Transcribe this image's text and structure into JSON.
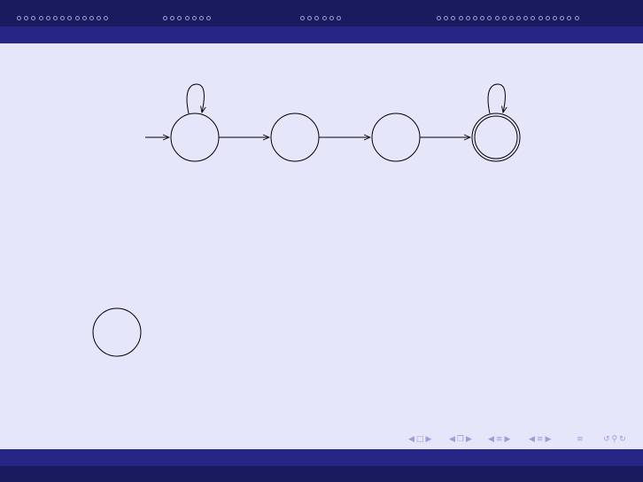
{
  "header": {
    "sections": [
      {
        "id": "s1",
        "dots": 13
      },
      {
        "id": "s2",
        "dots": 7
      },
      {
        "id": "s3",
        "dots": 6
      },
      {
        "id": "s4",
        "dots": 20
      }
    ]
  },
  "diagram": {
    "states": [
      {
        "id": "q0",
        "initial": true,
        "accepting": false,
        "self_loop": true,
        "label": ""
      },
      {
        "id": "q1",
        "initial": false,
        "accepting": false,
        "self_loop": false,
        "label": ""
      },
      {
        "id": "q2",
        "initial": false,
        "accepting": false,
        "self_loop": false,
        "label": ""
      },
      {
        "id": "q3",
        "initial": false,
        "accepting": true,
        "self_loop": true,
        "label": ""
      },
      {
        "id": "q4",
        "initial": false,
        "accepting": false,
        "self_loop": false,
        "label": ""
      }
    ],
    "transitions": [
      {
        "from": "q0",
        "to": "q0",
        "label": ""
      },
      {
        "from": "q0",
        "to": "q1",
        "label": ""
      },
      {
        "from": "q1",
        "to": "q2",
        "label": ""
      },
      {
        "from": "q2",
        "to": "q3",
        "label": ""
      },
      {
        "from": "q3",
        "to": "q3",
        "label": ""
      }
    ]
  },
  "nav_controls": {
    "icons": [
      "prev-frame-icon",
      "frame-icon",
      "next-frame-icon",
      "prev-subsection-icon",
      "subsection-icon",
      "next-subsection-icon",
      "prev-section-icon",
      "section-icon",
      "next-section-icon",
      "prev-slide-icon",
      "slide-icon",
      "next-slide-icon",
      "appendix-icon",
      "back-icon",
      "search-icon",
      "forward-icon"
    ],
    "color": "#9c9cd9"
  }
}
